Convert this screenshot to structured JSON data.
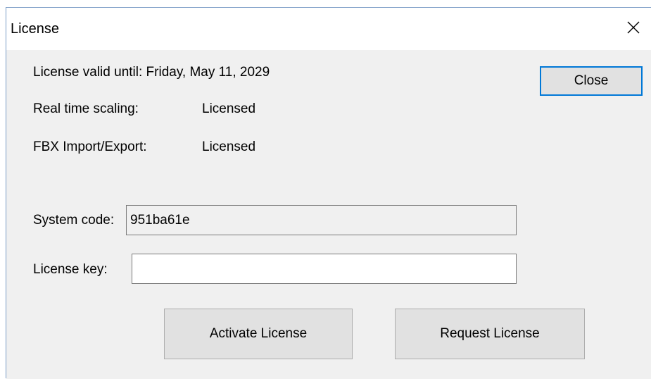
{
  "window": {
    "title": "License"
  },
  "license": {
    "valid_until_label": "License valid until: Friday, May 11, 2029",
    "features": [
      {
        "name": "Real time scaling:",
        "status": "Licensed"
      },
      {
        "name": "FBX Import/Export:",
        "status": "Licensed"
      }
    ]
  },
  "form": {
    "system_code_label": "System code:",
    "system_code_value": "951ba61e",
    "license_key_label": "License key:",
    "license_key_value": ""
  },
  "buttons": {
    "close": "Close",
    "activate": "Activate License",
    "request": "Request License"
  },
  "icons": {
    "title_close": "close-icon"
  },
  "colors": {
    "accent": "#0078d7",
    "button_face": "#e1e1e1",
    "dialog_background": "#f0f0f0"
  }
}
